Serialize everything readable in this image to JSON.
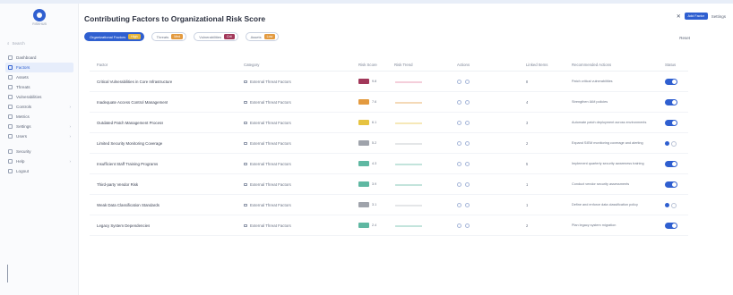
{
  "app": {
    "title": "Contributing Factors to Organizational Risk Score",
    "logo_text": "RISKHUB"
  },
  "sidebar": {
    "search_placeholder": "Search",
    "items": [
      {
        "label": "Dashboard",
        "icon": "dashboard-icon",
        "active": false
      },
      {
        "label": "Factors",
        "icon": "factors-icon",
        "active": true
      },
      {
        "label": "Assets",
        "icon": "assets-icon",
        "active": false
      },
      {
        "label": "Threats",
        "icon": "threats-icon",
        "active": false
      },
      {
        "label": "Vulnerabilities",
        "icon": "vulnerability-icon",
        "active": false
      },
      {
        "label": "Controls",
        "icon": "controls-icon",
        "active": false,
        "chevron": "›"
      },
      {
        "label": "Metrics",
        "icon": "metrics-icon",
        "active": false
      },
      {
        "label": "Settings",
        "icon": "settings-icon",
        "active": false,
        "chevron": "›"
      },
      {
        "label": "Users",
        "icon": "users-icon",
        "active": false,
        "chevron": "›"
      },
      {
        "label": "Security",
        "icon": "security-icon",
        "active": false
      },
      {
        "label": "Help",
        "icon": "help-icon",
        "active": false,
        "chevron": "›"
      },
      {
        "label": "Logout",
        "icon": "logout-icon",
        "active": false
      }
    ]
  },
  "header": {
    "close": "✕",
    "primary_button": "Add Factor",
    "secondary_button": "Settings",
    "reset": "Reset"
  },
  "filters": [
    {
      "label": "Organizational Factors",
      "badge": "High",
      "badge_color": "#e6b53a",
      "primary": true
    },
    {
      "label": "Threats",
      "badge": "Med",
      "badge_color": "#e39a3f",
      "primary": false
    },
    {
      "label": "Vulnerabilities",
      "badge": "Crit",
      "badge_color": "#a2385a",
      "primary": false
    },
    {
      "label": "Assets",
      "badge": "Low",
      "badge_color": "#e39a3f",
      "primary": false
    }
  ],
  "table": {
    "columns": [
      "Factor",
      "Category",
      "Risk Score",
      "Risk Trend",
      "Actions",
      "Linked Items",
      "Recommended Actions",
      "Status"
    ],
    "rows": [
      {
        "factor": "Critical Vulnerabilities in Core Infrastructure",
        "category": "External Threat Factors",
        "risk_color": "#a2385a",
        "risk_value": "9.8",
        "trend_color": "#e07c9d",
        "linked": "8",
        "recommendation": "Patch critical vulnerabilities",
        "status_on": true
      },
      {
        "factor": "Inadequate Access Control Management",
        "category": "External Threat Factors",
        "risk_color": "#e39a3f",
        "risk_value": "7.6",
        "trend_color": "#e39a3f",
        "linked": "4",
        "recommendation": "Strengthen IAM policies",
        "status_on": true
      },
      {
        "factor": "Outdated Patch Management Process",
        "category": "External Threat Factors",
        "risk_color": "#e6c341",
        "risk_value": "6.1",
        "trend_color": "#e6c341",
        "linked": "3",
        "recommendation": "Automate patch deployment across environments",
        "status_on": true
      },
      {
        "factor": "Limited Security Monitoring Coverage",
        "category": "External Threat Factors",
        "risk_color": "#9fa3ab",
        "risk_value": "5.2",
        "trend_color": "#b7bbc3",
        "linked": "2",
        "recommendation": "Expand SIEM monitoring coverage and alerting",
        "status_on": false
      },
      {
        "factor": "Insufficient Staff Training Programs",
        "category": "External Threat Factors",
        "risk_color": "#5fb8a2",
        "risk_value": "4.3",
        "trend_color": "#5fb8a2",
        "linked": "5",
        "recommendation": "Implement quarterly security awareness training",
        "status_on": true
      },
      {
        "factor": "Third-party Vendor Risk",
        "category": "External Threat Factors",
        "risk_color": "#5fb8a2",
        "risk_value": "3.9",
        "trend_color": "#5fb8a2",
        "linked": "1",
        "recommendation": "Conduct vendor security assessments",
        "status_on": true
      },
      {
        "factor": "Weak Data Classification Standards",
        "category": "External Threat Factors",
        "risk_color": "#9fa3ab",
        "risk_value": "3.1",
        "trend_color": "#b7bbc3",
        "linked": "1",
        "recommendation": "Define and enforce data classification policy",
        "status_on": false
      },
      {
        "factor": "Legacy System Dependencies",
        "category": "External Threat Factors",
        "risk_color": "#5fb8a2",
        "risk_value": "2.4",
        "trend_color": "#5fb8a2",
        "linked": "2",
        "recommendation": "Plan legacy system migration",
        "status_on": true
      }
    ]
  }
}
